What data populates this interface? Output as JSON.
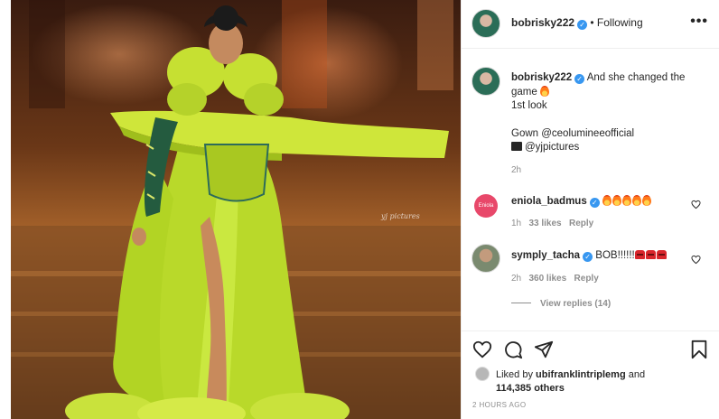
{
  "post": {
    "username": "bobrisky222",
    "follow_status": "• Following",
    "more_label": "•••"
  },
  "caption": {
    "username": "bobrisky222",
    "text_line1": "And she changed the",
    "text_line2": "game",
    "look": "1st look",
    "gown": "Gown @ceolumineeofficial",
    "pictures": "@yjpictures",
    "age": "2h"
  },
  "comments": [
    {
      "username": "eniola_badmus",
      "avatar_text": "Eniola",
      "fire_count": 5,
      "age": "1h",
      "likes": "33 likes",
      "reply": "Reply"
    },
    {
      "username": "symply_tacha",
      "text": "BOB!!!!!!",
      "emoji_count": 3,
      "age": "2h",
      "likes": "360 likes",
      "reply": "Reply"
    }
  ],
  "view_replies": "View replies (14)",
  "likes": {
    "prefix": "Liked by",
    "user": "ubifranklintriplemg",
    "and": "and",
    "count": "114,385 others"
  },
  "timestamp": "2 HOURS AGO",
  "icons": [
    "heart-icon",
    "comment-icon",
    "share-icon",
    "bookmark-icon",
    "verified-icon",
    "fire-emoji",
    "clapper-emoji",
    "red-face-emoji"
  ],
  "colors": {
    "verified": "#3897f0",
    "gown": "#c8e53a",
    "muted": "#8e8e8e"
  }
}
